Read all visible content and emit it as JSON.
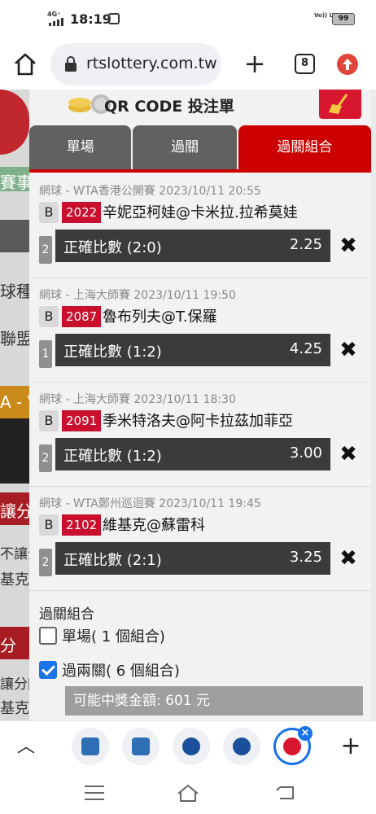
{
  "status_bar": {
    "network": "4G⁺",
    "time": "18:19",
    "volte": "Vo)) LTE",
    "battery": "99"
  },
  "browser": {
    "url": "rtslottery.com.tw",
    "tab_count": "8"
  },
  "background": {
    "texts": [
      "賽事",
      "球種",
      "聯盟",
      "A - V",
      "讓分",
      "不讓分",
      "基克",
      "分",
      "讓分[",
      "基克"
    ]
  },
  "modal": {
    "title": "QR CODE 投注單",
    "tabs": [
      {
        "label": "單場"
      },
      {
        "label": "過關"
      },
      {
        "label": "過關組合"
      }
    ],
    "bets": [
      {
        "meta": "網球 - WTA香港公開賽 2023/10/11 20:55",
        "b": "B",
        "code": "2022",
        "teams": "辛妮亞柯娃@卡米拉.拉希莫娃",
        "count": "2",
        "selection": "正確比數 (2:0)",
        "odds": "2.25"
      },
      {
        "meta": "網球 - 上海大師賽 2023/10/11 19:50",
        "b": "B",
        "code": "2087",
        "teams": "魯布列夫@T.保羅",
        "count": "1",
        "selection": "正確比數 (1:2)",
        "odds": "4.25"
      },
      {
        "meta": "網球 - 上海大師賽 2023/10/11 18:30",
        "b": "B",
        "code": "2091",
        "teams": "季米特洛夫@阿卡拉茲加菲亞",
        "count": "2",
        "selection": "正確比數 (1:2)",
        "odds": "3.00"
      },
      {
        "meta": "網球 - WTA鄭州巡迴賽 2023/10/11 19:45",
        "b": "B",
        "code": "2102",
        "teams": "維基克@蘇雷科",
        "count": "2",
        "selection": "正確比數 (2:1)",
        "odds": "3.25"
      }
    ],
    "combo": {
      "title": "過關組合",
      "options": [
        {
          "label": "單場( 1 個組合)",
          "checked": false
        },
        {
          "label": "過兩關( 6 個組合)",
          "checked": true
        }
      ],
      "prize": "可能中獎金額: 601 元"
    }
  },
  "bottom_bar": {
    "badge": "×"
  },
  "colors": {
    "accent_red": "#cc0000",
    "tab_gray": "#616161",
    "selection_bg": "#3b3b3b",
    "checkbox_blue": "#1a73e8"
  },
  "icons": {
    "home": "home-icon",
    "lock": "lock-icon",
    "plus": "plus-icon",
    "update": "update-icon",
    "remove": "close-icon"
  }
}
